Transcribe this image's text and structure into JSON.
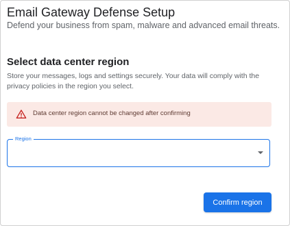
{
  "header": {
    "title": "Email Gateway Defense Setup",
    "subtitle": "Defend your business from spam, malware and advanced email threats."
  },
  "section": {
    "title": "Select data center region",
    "description": "Store your messages, logs and settings securely. Your data will comply with the privacy policies in the region you select."
  },
  "warning": {
    "icon": "warning-triangle-icon",
    "text": "Data center region cannot be changed after confirming",
    "background_color": "#fbe9e5",
    "icon_color": "#c5221f"
  },
  "region_select": {
    "label": "Region",
    "value": "",
    "accent_color": "#1a73e8"
  },
  "actions": {
    "confirm_label": "Confirm region"
  },
  "colors": {
    "primary": "#1a73e8",
    "text_primary": "#202124",
    "text_secondary": "#5f6368"
  }
}
